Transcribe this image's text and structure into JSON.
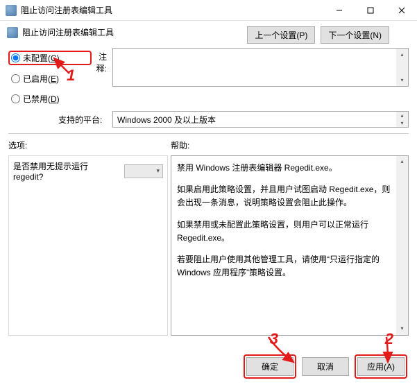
{
  "window": {
    "title": "阻止访问注册表编辑工具",
    "subtitle": "阻止访问注册表编辑工具"
  },
  "topButtons": {
    "prev": "上一个设置(P)",
    "next": "下一个设置(N)"
  },
  "radios": {
    "notConfigured": {
      "text": "未配置(",
      "key": "C",
      "suffix": ")"
    },
    "enabled": {
      "text": "已启用(",
      "key": "E",
      "suffix": ")"
    },
    "disabled": {
      "text": "已禁用(",
      "key": "D",
      "suffix": ")"
    }
  },
  "labels": {
    "comment": "注释:",
    "platform": "支持的平台:",
    "options": "选项:",
    "help": "帮助:"
  },
  "platformText": "Windows 2000 及以上版本",
  "optionQuestion": "是否禁用无提示运行 regedit?",
  "helpText": {
    "p1": "禁用 Windows 注册表编辑器 Regedit.exe。",
    "p2": "如果启用此策略设置，并且用户试图启动 Regedit.exe，则会出现一条消息，说明策略设置会阻止此操作。",
    "p3": "如果禁用或未配置此策略设置，则用户可以正常运行 Regedit.exe。",
    "p4": "若要阻止用户使用其他管理工具，请使用“只运行指定的 Windows 应用程序”策略设置。"
  },
  "footer": {
    "ok": "确定",
    "cancel": "取消",
    "apply": "应用(A)"
  },
  "annotations": {
    "n1": "1",
    "n2": "2",
    "n3": "3"
  }
}
